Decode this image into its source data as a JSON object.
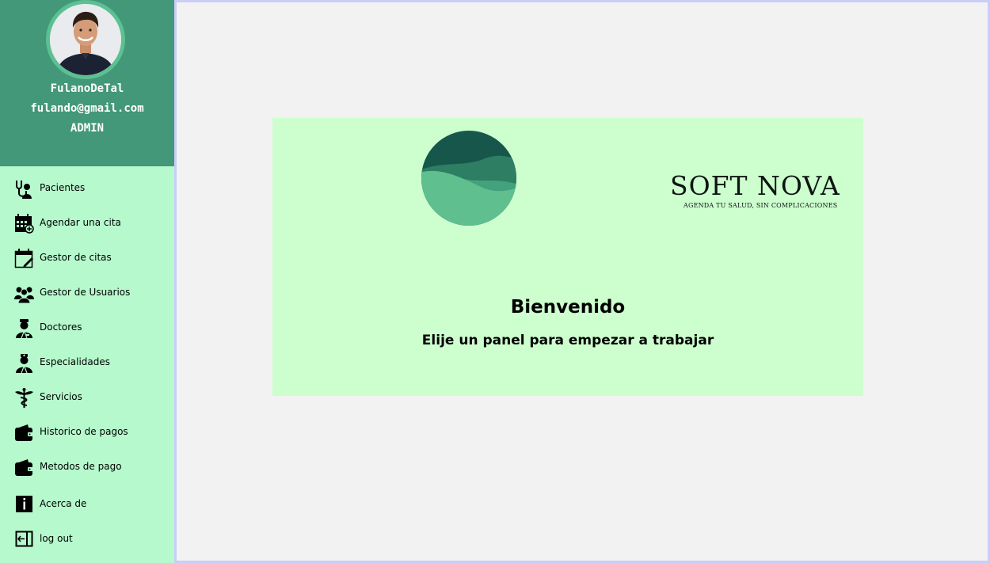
{
  "profile": {
    "name": "FulanoDeTal",
    "email": "fulando@gmail.com",
    "role": "ADMIN"
  },
  "nav": {
    "items": [
      {
        "label": "Pacientes",
        "icon": "stethoscope-icon"
      },
      {
        "label": "Agendar una cita",
        "icon": "calendar-add-icon"
      },
      {
        "label": "Gestor de citas",
        "icon": "calendar-edit-icon"
      },
      {
        "label": "Gestor de Usuarios",
        "icon": "users-icon"
      },
      {
        "label": "Doctores",
        "icon": "doctor-icon"
      },
      {
        "label": "Especialidades",
        "icon": "specialist-icon"
      },
      {
        "label": "Servicios",
        "icon": "caduceus-icon"
      },
      {
        "label": "Historico de pagos",
        "icon": "wallet-icon"
      },
      {
        "label": "Metodos de pago",
        "icon": "wallet-icon"
      },
      {
        "label": "Acerca de",
        "icon": "info-icon"
      },
      {
        "label": "log out",
        "icon": "logout-icon"
      }
    ]
  },
  "main": {
    "brand": "SOFT NOVA",
    "tagline": "AGENDA TU SALUD, SIN COMPLICACIONES",
    "welcome": "Bienvenido",
    "subtitle": "Elije un panel para empezar a trabajar"
  },
  "colors": {
    "profile_bg": "#429878",
    "sidebar_bg": "#b6f9cd",
    "card_bg": "#cdfece",
    "main_bg": "#f2f2f2"
  }
}
